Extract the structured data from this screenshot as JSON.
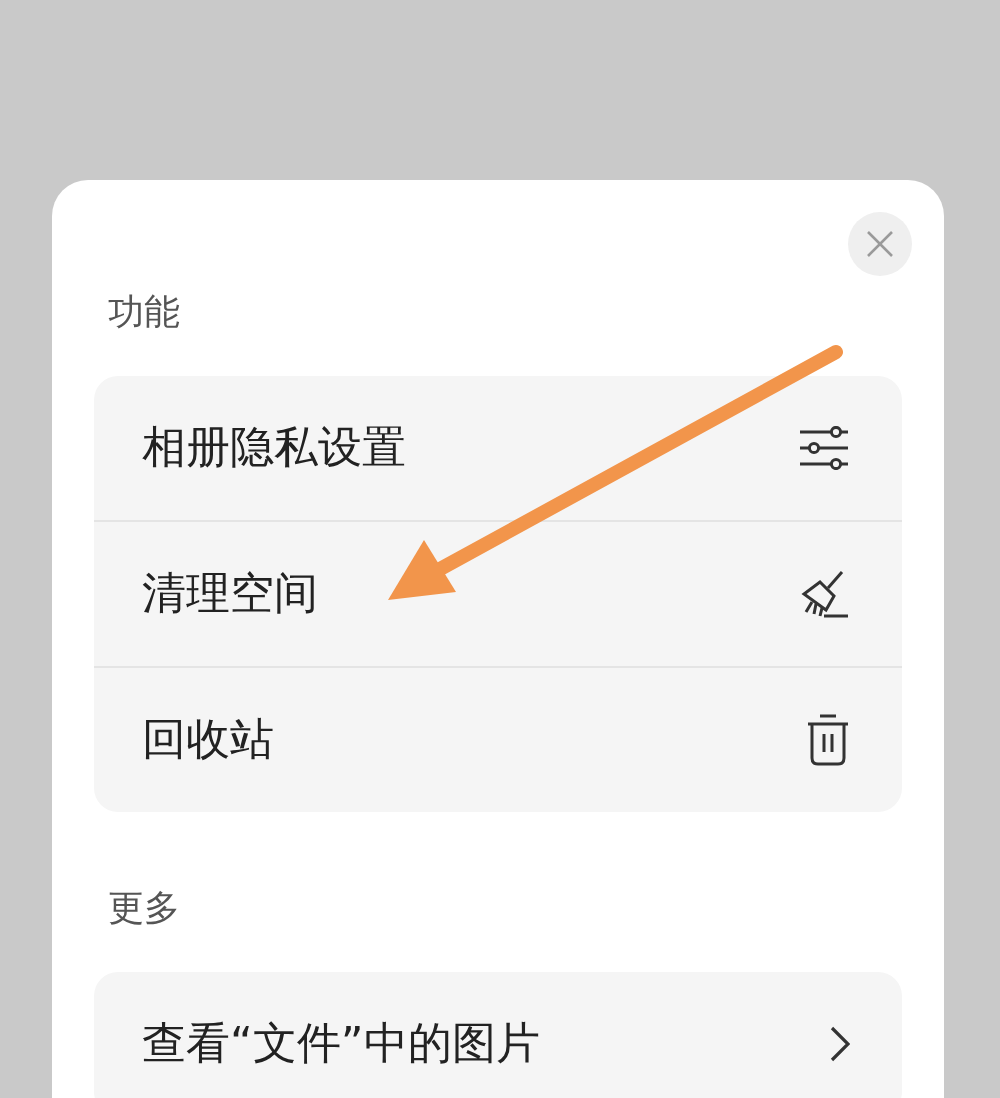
{
  "sections": [
    {
      "title": "功能",
      "items": [
        {
          "label": "相册隐私设置",
          "kind": "sliders"
        },
        {
          "label": "清理空间",
          "kind": "broom"
        },
        {
          "label": "回收站",
          "kind": "trash"
        }
      ]
    },
    {
      "title": "更多",
      "items": [
        {
          "label": "查看“文件”中的图片",
          "kind": "chevron"
        }
      ]
    }
  ]
}
